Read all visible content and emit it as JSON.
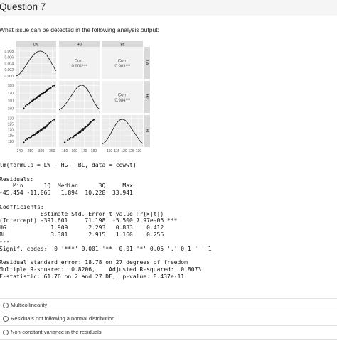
{
  "header": {
    "title": "Question 7"
  },
  "question": {
    "text": "What issue can be detected in the following analysis output:"
  },
  "chart_data": {
    "type": "scatter",
    "variables": [
      "LW",
      "HG",
      "BL"
    ],
    "strip_labels": [
      "LW",
      "HG",
      "BL"
    ],
    "diagonal_density_ticks": [
      "0.008",
      "0.006",
      "0.004",
      "0.002",
      "0.000"
    ],
    "correlations": [
      {
        "pair": [
          "LW",
          "HG"
        ],
        "label": "Corr:",
        "value": "0.901***"
      },
      {
        "pair": [
          "LW",
          "BL"
        ],
        "label": "Corr:",
        "value": "0.903***"
      },
      {
        "pair": [
          "HG",
          "BL"
        ],
        "label": "Corr:",
        "value": "0.984***"
      }
    ],
    "axes": {
      "LW": {
        "range": [
          225,
          375
        ],
        "ticks": [
          "240",
          "280",
          "320",
          "360"
        ]
      },
      "HG": {
        "range": [
          144,
          186
        ],
        "ticks": [
          "150",
          "160",
          "170",
          "180"
        ]
      },
      "BL": {
        "range": [
          105,
          133
        ],
        "ticks": [
          "110",
          "115",
          "120",
          "125",
          "130"
        ]
      }
    },
    "points": [
      {
        "LW": 255,
        "HG": 150,
        "BL": 109
      },
      {
        "LW": 262,
        "HG": 153,
        "BL": 111
      },
      {
        "LW": 268,
        "HG": 155,
        "BL": 112
      },
      {
        "LW": 275,
        "HG": 156,
        "BL": 113
      },
      {
        "LW": 278,
        "HG": 158,
        "BL": 113
      },
      {
        "LW": 283,
        "HG": 159,
        "BL": 114
      },
      {
        "LW": 287,
        "HG": 160,
        "BL": 115
      },
      {
        "LW": 291,
        "HG": 161,
        "BL": 115
      },
      {
        "LW": 294,
        "HG": 162,
        "BL": 116
      },
      {
        "LW": 297,
        "HG": 162,
        "BL": 116
      },
      {
        "LW": 300,
        "HG": 163,
        "BL": 117
      },
      {
        "LW": 303,
        "HG": 164,
        "BL": 117
      },
      {
        "LW": 306,
        "HG": 165,
        "BL": 118
      },
      {
        "LW": 309,
        "HG": 166,
        "BL": 118
      },
      {
        "LW": 312,
        "HG": 166,
        "BL": 119
      },
      {
        "LW": 315,
        "HG": 167,
        "BL": 119
      },
      {
        "LW": 318,
        "HG": 168,
        "BL": 120
      },
      {
        "LW": 321,
        "HG": 169,
        "BL": 120
      },
      {
        "LW": 324,
        "HG": 169,
        "BL": 121
      },
      {
        "LW": 327,
        "HG": 170,
        "BL": 121
      },
      {
        "LW": 330,
        "HG": 171,
        "BL": 122
      },
      {
        "LW": 333,
        "HG": 171,
        "BL": 122
      },
      {
        "LW": 336,
        "HG": 172,
        "BL": 123
      },
      {
        "LW": 339,
        "HG": 173,
        "BL": 123
      },
      {
        "LW": 342,
        "HG": 174,
        "BL": 124
      },
      {
        "LW": 346,
        "HG": 175,
        "BL": 125
      },
      {
        "LW": 350,
        "HG": 176,
        "BL": 126
      },
      {
        "LW": 355,
        "HG": 177,
        "BL": 127
      },
      {
        "LW": 362,
        "HG": 179,
        "BL": 128
      },
      {
        "LW": 368,
        "HG": 180,
        "BL": 129
      }
    ]
  },
  "r_output": {
    "lines": [
      "lm(formula = LW ~ HG + BL, data = cowwt)",
      "",
      "Residuals:",
      "    Min      1Q  Median      3Q     Max",
      "-45.454 -11.066   1.894  10.228  33.941",
      "",
      "Coefficients:",
      "            Estimate Std. Error t value Pr(>|t|)",
      "(Intercept) -391.601     71.198  -5.500 7.97e-06 ***",
      "HG             1.909      2.293   0.833    0.412",
      "BL             3.381      2.915   1.160    0.256",
      "---",
      "Signif. codes:  0 '***' 0.001 '**' 0.01 '*' 0.05 '.' 0.1 ' ' 1",
      "",
      "Residual standard error: 18.78 on 27 degrees of freedom",
      "Multiple R-squared:  0.8206,    Adjusted R-squared:  0.8073",
      "F-statistic: 61.76 on 2 and 27 DF,  p-value: 8.437e-11"
    ]
  },
  "options": [
    {
      "label": "Multicollinearity"
    },
    {
      "label": "Residuals not following a normal distribution"
    },
    {
      "label": "Non-constant variance in the residuals"
    }
  ]
}
